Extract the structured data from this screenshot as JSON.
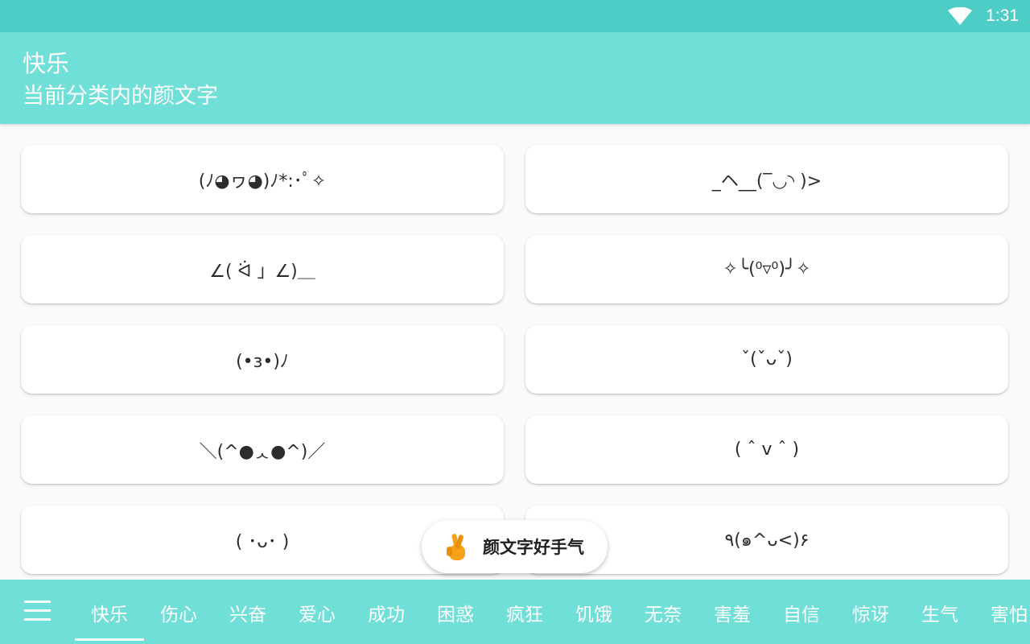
{
  "status": {
    "time": "1:31"
  },
  "header": {
    "title": "快乐",
    "subtitle": "当前分类内的颜文字"
  },
  "kaomoji": [
    "(ﾉ◕ヮ◕)ﾉ*:･ﾟ✧",
    "_ヘ__(‾◡◝ )>",
    "∠( ᐛ 」∠)＿",
    "✧╰(⁰▿⁰)╯✧",
    "(•ɜ•)ﾉ",
    "ˇ(ˇᴗˇ)",
    "＼(^●ᆺ●^)／",
    "( ˆ v ˆ )",
    "( ･ᴗ･ )",
    "٩(๑^ᴗ<)۶"
  ],
  "fab": {
    "label": "颜文字好手气",
    "icon": "crossed-fingers-icon"
  },
  "bottom_nav": {
    "menu_icon": "menu-icon",
    "tabs": [
      "快乐",
      "伤心",
      "兴奋",
      "爱心",
      "成功",
      "困惑",
      "疯狂",
      "饥饿",
      "无奈",
      "害羞",
      "自信",
      "惊讶",
      "生气",
      "害怕"
    ],
    "selected": "快乐"
  },
  "colors": {
    "primary": "#70dfd8",
    "status_bar": "#4ecdc6",
    "fab_icon": "#f6a11a"
  }
}
